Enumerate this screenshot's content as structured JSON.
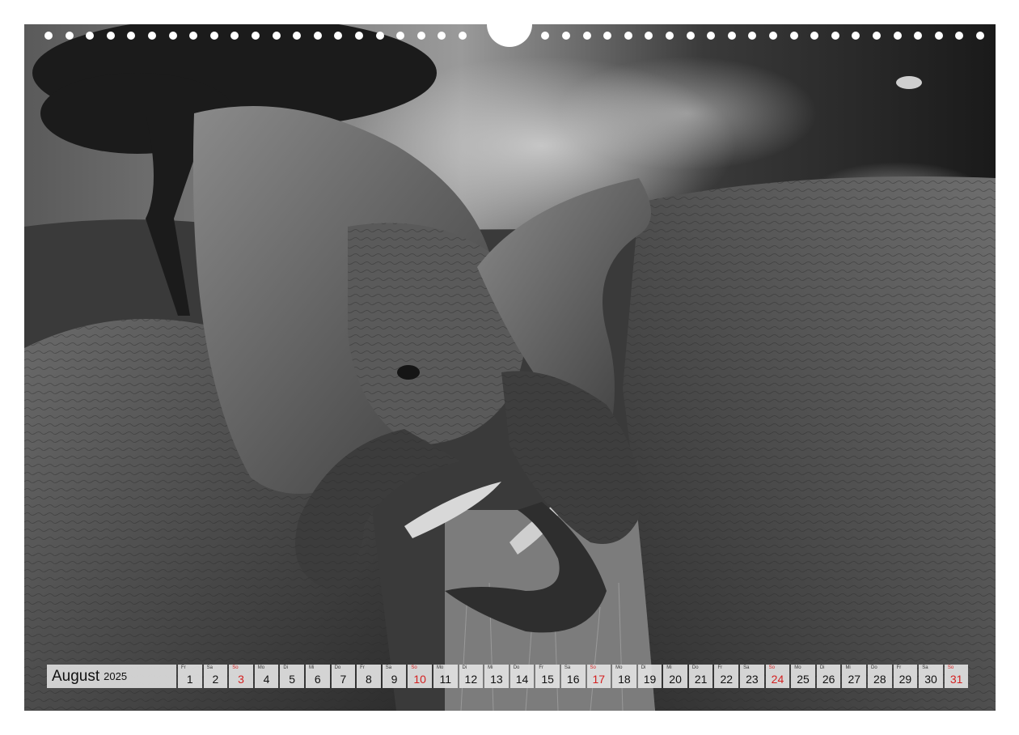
{
  "calendar": {
    "month": "August",
    "year": "2025",
    "sunday_color": "#d42020",
    "days": [
      {
        "abbr": "Fr",
        "num": "1",
        "sunday": false
      },
      {
        "abbr": "Sa",
        "num": "2",
        "sunday": false
      },
      {
        "abbr": "So",
        "num": "3",
        "sunday": true
      },
      {
        "abbr": "Mo",
        "num": "4",
        "sunday": false
      },
      {
        "abbr": "Di",
        "num": "5",
        "sunday": false
      },
      {
        "abbr": "Mi",
        "num": "6",
        "sunday": false
      },
      {
        "abbr": "Do",
        "num": "7",
        "sunday": false
      },
      {
        "abbr": "Fr",
        "num": "8",
        "sunday": false
      },
      {
        "abbr": "Sa",
        "num": "9",
        "sunday": false
      },
      {
        "abbr": "So",
        "num": "10",
        "sunday": true
      },
      {
        "abbr": "Mo",
        "num": "11",
        "sunday": false
      },
      {
        "abbr": "Di",
        "num": "12",
        "sunday": false
      },
      {
        "abbr": "Mi",
        "num": "13",
        "sunday": false
      },
      {
        "abbr": "Do",
        "num": "14",
        "sunday": false
      },
      {
        "abbr": "Fr",
        "num": "15",
        "sunday": false
      },
      {
        "abbr": "Sa",
        "num": "16",
        "sunday": false
      },
      {
        "abbr": "So",
        "num": "17",
        "sunday": true
      },
      {
        "abbr": "Mo",
        "num": "18",
        "sunday": false
      },
      {
        "abbr": "Di",
        "num": "19",
        "sunday": false
      },
      {
        "abbr": "Mi",
        "num": "20",
        "sunday": false
      },
      {
        "abbr": "Do",
        "num": "21",
        "sunday": false
      },
      {
        "abbr": "Fr",
        "num": "22",
        "sunday": false
      },
      {
        "abbr": "Sa",
        "num": "23",
        "sunday": false
      },
      {
        "abbr": "So",
        "num": "24",
        "sunday": true
      },
      {
        "abbr": "Mo",
        "num": "25",
        "sunday": false
      },
      {
        "abbr": "Di",
        "num": "26",
        "sunday": false
      },
      {
        "abbr": "Mi",
        "num": "27",
        "sunday": false
      },
      {
        "abbr": "Do",
        "num": "28",
        "sunday": false
      },
      {
        "abbr": "Fr",
        "num": "29",
        "sunday": false
      },
      {
        "abbr": "Sa",
        "num": "30",
        "sunday": false
      },
      {
        "abbr": "So",
        "num": "31",
        "sunday": true
      }
    ]
  },
  "photo": {
    "subject": "two-elephants-black-and-white",
    "palette": {
      "sky_dark": "#1e1e1e",
      "sky_light": "#bdbdbd",
      "skin": "#4a4a4a",
      "grass": "#8a8a8a"
    }
  }
}
